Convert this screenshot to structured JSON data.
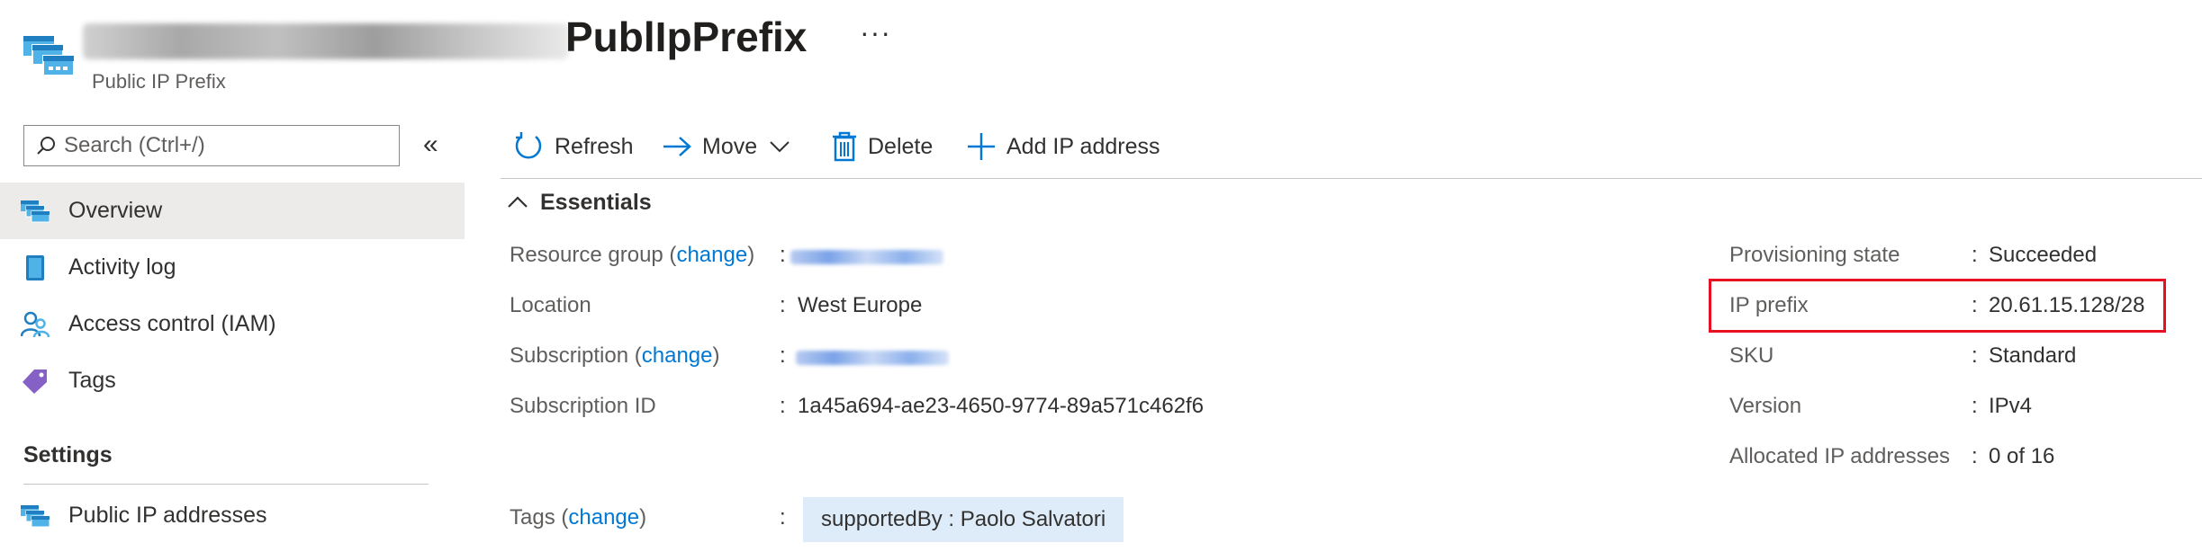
{
  "header": {
    "title": "PublIpPrefix",
    "subtitle": "Public IP Prefix",
    "more_label": "···"
  },
  "sidebar": {
    "search_placeholder": "Search (Ctrl+/)",
    "collapse_label": "«",
    "items": [
      {
        "label": "Overview",
        "icon": "overview-icon",
        "active": true
      },
      {
        "label": "Activity log",
        "icon": "activity-log-icon"
      },
      {
        "label": "Access control (IAM)",
        "icon": "iam-icon"
      },
      {
        "label": "Tags",
        "icon": "tag-icon"
      }
    ],
    "settings_header": "Settings",
    "settings_items": [
      {
        "label": "Public IP addresses",
        "icon": "public-ip-icon"
      }
    ]
  },
  "toolbar": {
    "refresh": "Refresh",
    "move": "Move",
    "delete": "Delete",
    "add_ip": "Add IP address"
  },
  "essentials": {
    "header": "Essentials",
    "change_label": "change",
    "left": {
      "resource_group_label": "Resource group",
      "location_label": "Location",
      "location_value": "West Europe",
      "subscription_label": "Subscription",
      "subscription_id_label": "Subscription ID",
      "subscription_id_value": "1a45a694-ae23-4650-9774-89a571c462f6",
      "tags_label": "Tags",
      "tag_value": "supportedBy : Paolo Salvatori"
    },
    "right": {
      "provisioning_label": "Provisioning state",
      "provisioning_value": "Succeeded",
      "ip_prefix_label": "IP prefix",
      "ip_prefix_value": "20.61.15.128/28",
      "sku_label": "SKU",
      "sku_value": "Standard",
      "version_label": "Version",
      "version_value": "IPv4",
      "allocated_label": "Allocated IP addresses",
      "allocated_value": "0 of 16"
    }
  },
  "colors": {
    "accent": "#0078d4",
    "highlight": "#e81123",
    "tag_bg": "#deecf9",
    "active_nav_bg": "#edebe9"
  }
}
